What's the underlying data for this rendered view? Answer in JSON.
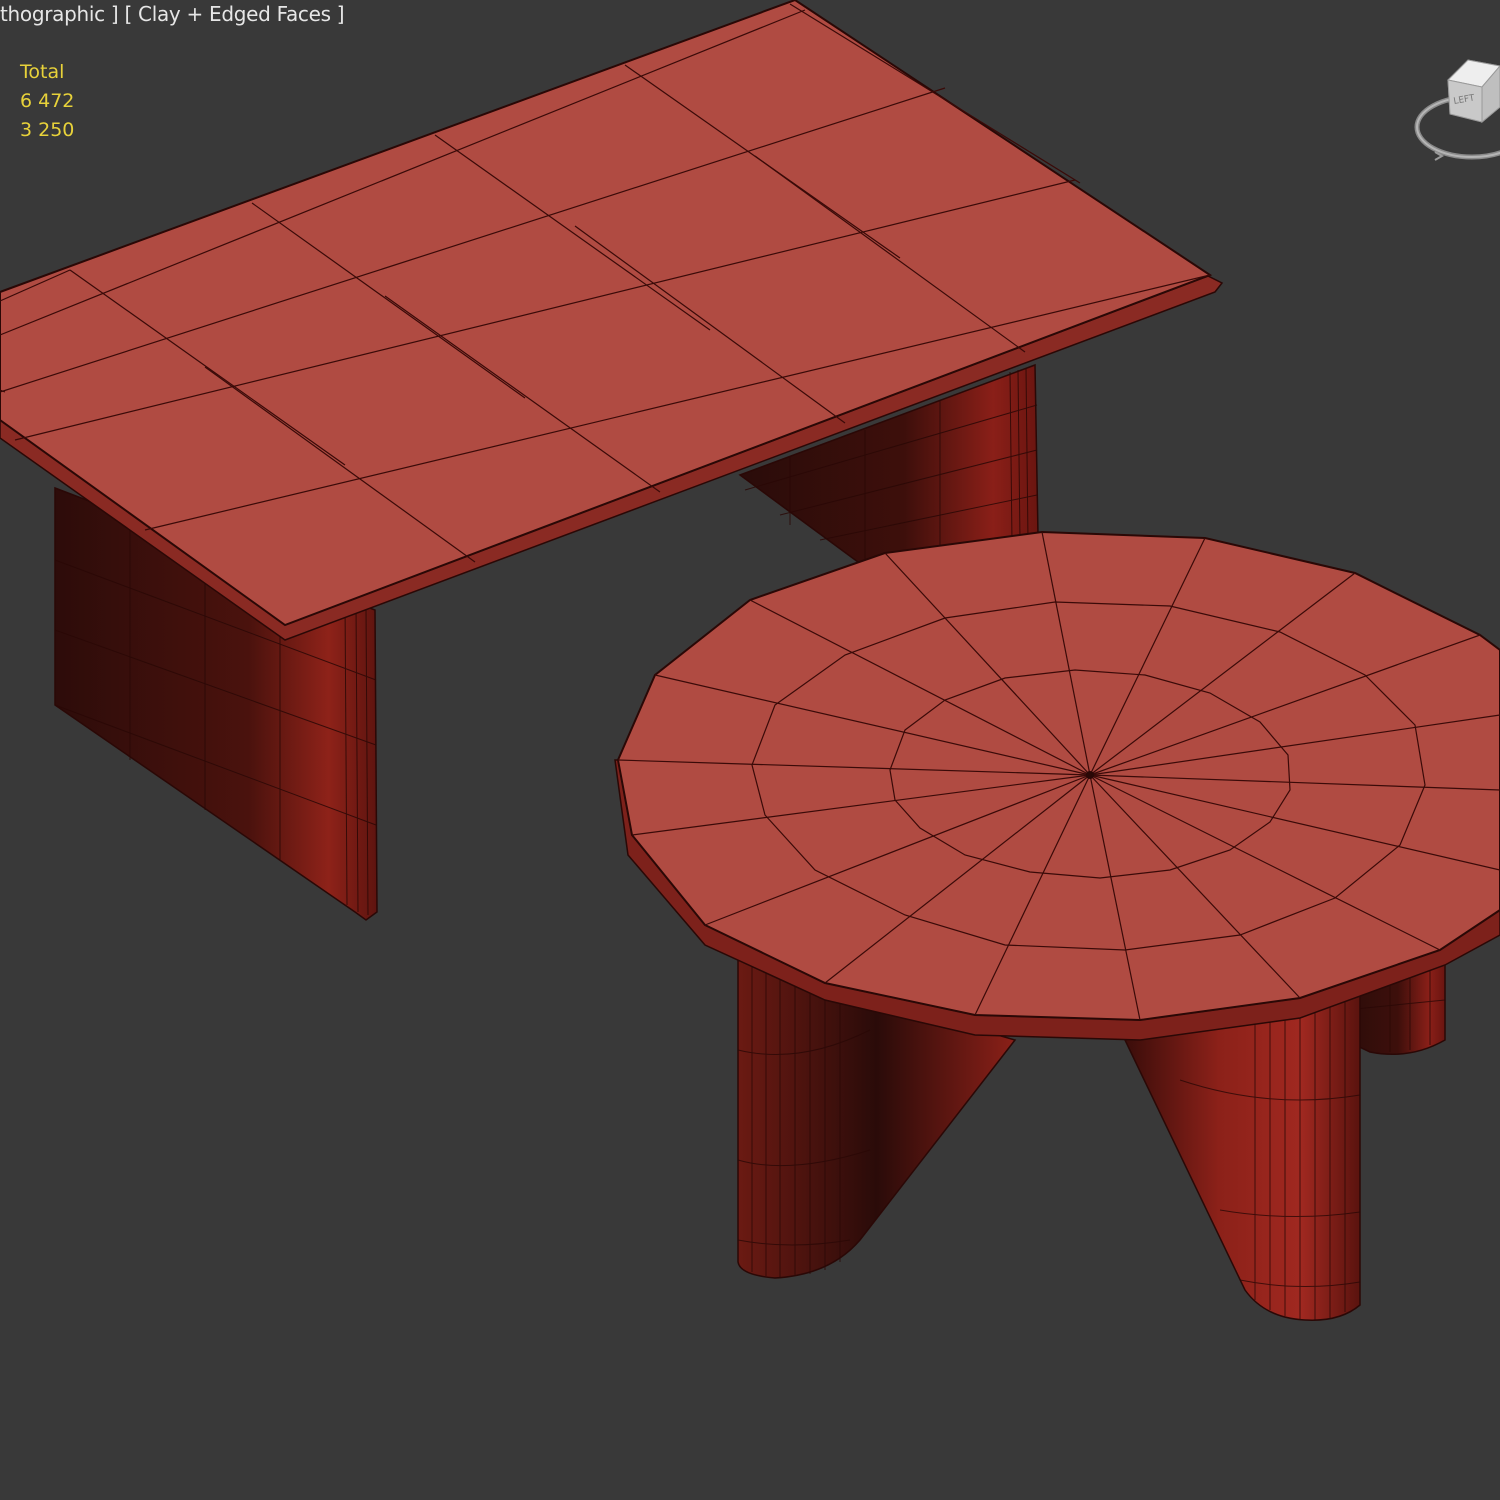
{
  "viewport": {
    "label": "thographic ] [ Clay + Edged Faces ]",
    "background": "#393939",
    "clay_color": "#b04b42",
    "edge_color": "#3a0a08"
  },
  "stats": {
    "title": "Total",
    "polys": "6 472",
    "verts": "3 250",
    "text_color": "#e8d23a"
  },
  "viewcube": {
    "face_label": "LEFT",
    "icon": "viewcube-icon"
  }
}
